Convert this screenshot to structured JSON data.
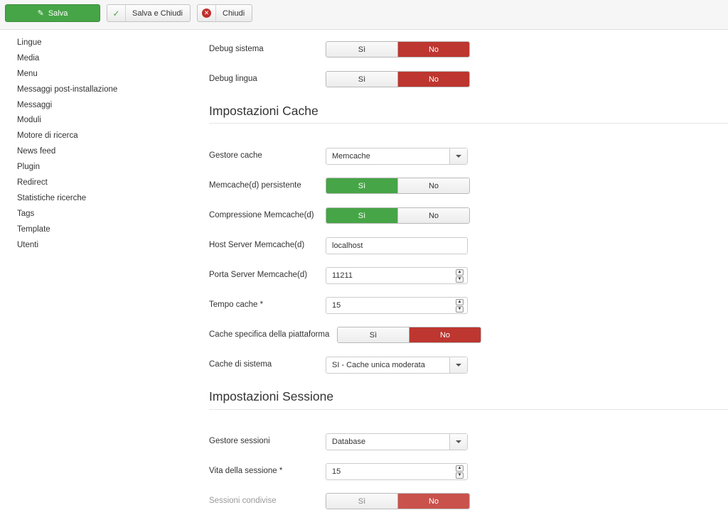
{
  "toolbar": {
    "save_label": "Salva",
    "save_close_label": "Salva e Chiudi",
    "close_label": "Chiudi"
  },
  "sidebar": {
    "items": [
      {
        "label": "Lingue"
      },
      {
        "label": "Media"
      },
      {
        "label": "Menu"
      },
      {
        "label": "Messaggi post-installazione"
      },
      {
        "label": "Messaggi"
      },
      {
        "label": "Moduli"
      },
      {
        "label": "Motore di ricerca"
      },
      {
        "label": "News feed"
      },
      {
        "label": "Plugin"
      },
      {
        "label": "Redirect"
      },
      {
        "label": "Statistiche ricerche"
      },
      {
        "label": "Tags"
      },
      {
        "label": "Template"
      },
      {
        "label": "Utenti"
      }
    ]
  },
  "debug": {
    "debug_system": {
      "label": "Debug sistema",
      "yes": "Sì",
      "no": "No",
      "selected": "No"
    },
    "debug_language": {
      "label": "Debug lingua",
      "yes": "Sì",
      "no": "No",
      "selected": "No"
    }
  },
  "cache": {
    "heading": "Impostazioni Cache",
    "handler": {
      "label": "Gestore cache",
      "value": "Memcache"
    },
    "persistent": {
      "label": "Memcache(d) persistente",
      "yes": "Sì",
      "no": "No",
      "selected": "Sì"
    },
    "compression": {
      "label": "Compressione Memcache(d)",
      "yes": "Sì",
      "no": "No",
      "selected": "Sì"
    },
    "host": {
      "label": "Host Server Memcache(d)",
      "value": "localhost"
    },
    "port": {
      "label": "Porta Server Memcache(d)",
      "value": "11211"
    },
    "time": {
      "label": "Tempo cache *",
      "value": "15"
    },
    "platform": {
      "label": "Cache specifica della piattaforma",
      "yes": "Sì",
      "no": "No",
      "selected": "No"
    },
    "system": {
      "label": "Cache di sistema",
      "value": "SI - Cache unica moderata"
    }
  },
  "session": {
    "heading": "Impostazioni Sessione",
    "handler": {
      "label": "Gestore sessioni",
      "value": "Database"
    },
    "lifetime": {
      "label": "Vita della sessione *",
      "value": "15"
    },
    "shared": {
      "label": "Sessioni condivise",
      "yes": "Sì",
      "no": "No",
      "selected": "No"
    }
  },
  "colors": {
    "success": "#46a546",
    "danger": "#bd362f"
  }
}
